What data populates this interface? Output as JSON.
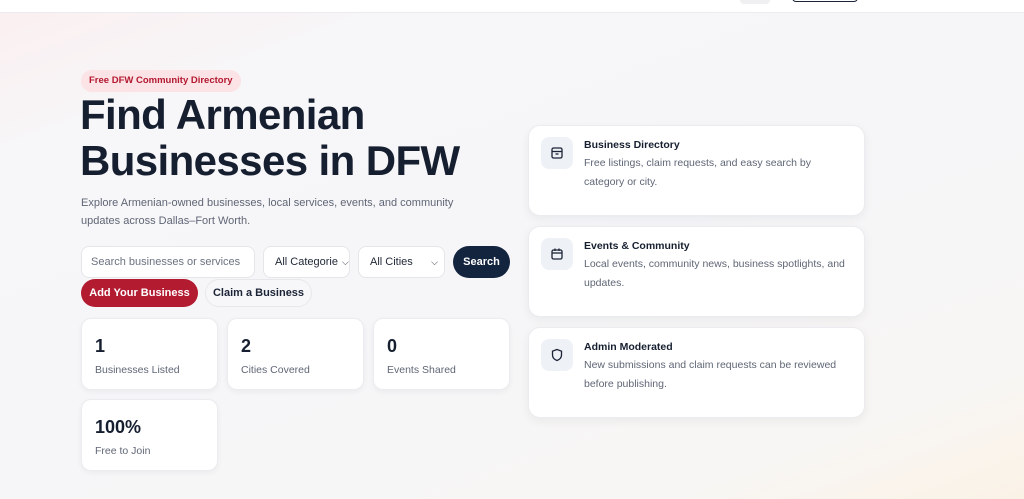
{
  "hero": {
    "badge": "Free DFW Community Directory",
    "title": "Find Armenian Businesses in DFW",
    "subtitle": "Explore Armenian-owned businesses, local services, events, and community updates across Dallas–Fort Worth."
  },
  "search": {
    "placeholder": "Search businesses or services",
    "category_selected": "All Categorie",
    "city_selected": "All Cities",
    "button_label": "Search"
  },
  "actions": {
    "add_label": "Add Your Business",
    "claim_label": "Claim a Business"
  },
  "stats": [
    {
      "value": "1",
      "label": "Businesses Listed"
    },
    {
      "value": "2",
      "label": "Cities Covered"
    },
    {
      "value": "0",
      "label": "Events Shared"
    },
    {
      "value": "100%",
      "label": "Free to Join"
    }
  ],
  "features": [
    {
      "icon": "archive-box-icon",
      "title": "Business Directory",
      "description": "Free listings, claim requests, and easy search by category or city."
    },
    {
      "icon": "calendar-icon",
      "title": "Events & Community",
      "description": "Local events, community news, business spotlights, and updates."
    },
    {
      "icon": "shield-icon",
      "title": "Admin Moderated",
      "description": "New submissions and claim requests can be reviewed before publishing."
    }
  ],
  "colors": {
    "accent_red": "#b31b31",
    "navy": "#13243f",
    "badge_bg": "#fbe3e6"
  }
}
